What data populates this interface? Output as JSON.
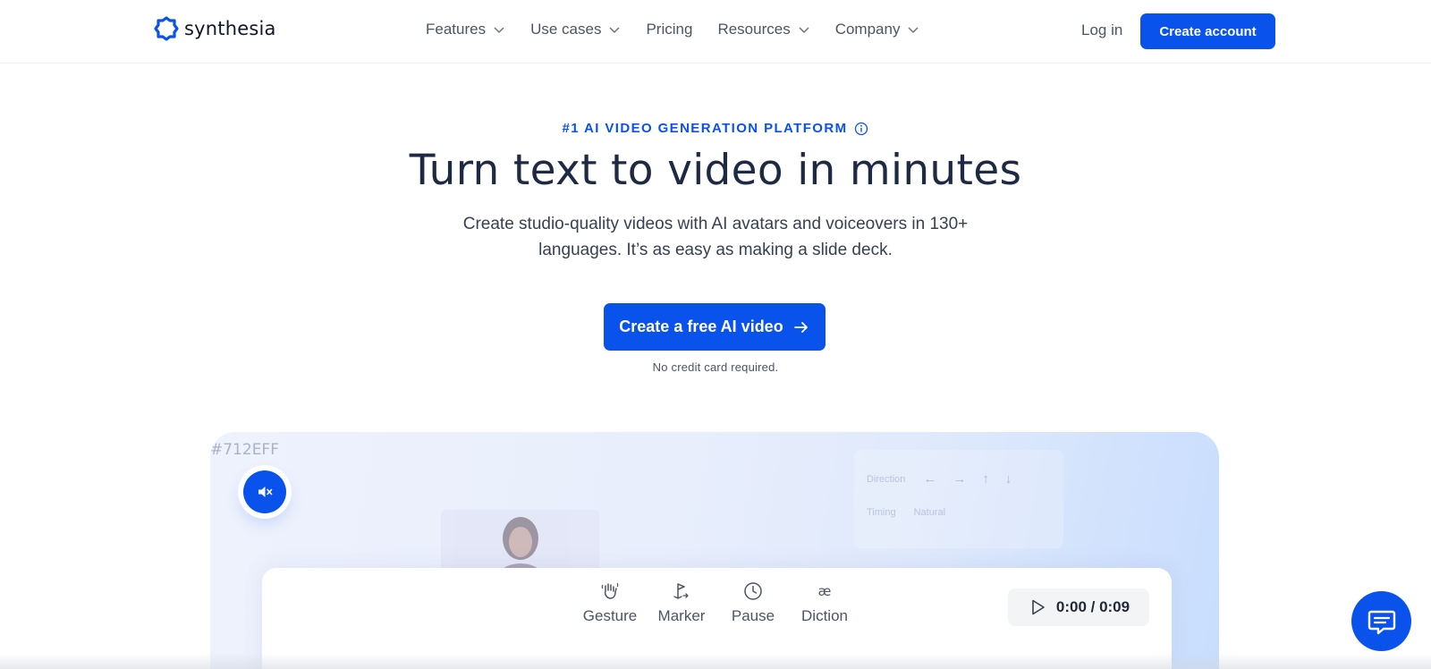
{
  "header": {
    "logo_text": "synthesia",
    "nav": [
      {
        "label": "Features",
        "dropdown": true
      },
      {
        "label": "Use cases",
        "dropdown": true
      },
      {
        "label": "Pricing",
        "dropdown": false
      },
      {
        "label": "Resources",
        "dropdown": true
      },
      {
        "label": "Company",
        "dropdown": true
      }
    ],
    "login_label": "Log in",
    "create_account_label": "Create account"
  },
  "hero": {
    "eyebrow": "#1 AI VIDEO GENERATION PLATFORM",
    "title": "Turn text to video in minutes",
    "subtitle": "Create studio-quality videos with AI avatars and voiceovers in 130+ languages. It’s as easy as making a slide deck.",
    "cta_label": "Create a free AI video",
    "note": "No credit card required."
  },
  "preview": {
    "tag": "#712EFF",
    "mute_icon": "speaker-muted-icon",
    "ghost_panel": {
      "direction_label": "Direction",
      "arrows": [
        "←",
        "→",
        "↑",
        "↓"
      ],
      "timing_label": "Timing",
      "timing_value": "Natural"
    },
    "tools": [
      {
        "label": "Gesture",
        "icon": "hand-wave-icon"
      },
      {
        "label": "Marker",
        "icon": "marker-icon"
      },
      {
        "label": "Pause",
        "icon": "clock-icon"
      },
      {
        "label": "Diction",
        "icon": "diction-icon"
      }
    ],
    "timer": "0:00 / 0:09"
  },
  "chat": {
    "icon": "chat-icon"
  },
  "colors": {
    "brand": "#0A52EC",
    "title": "#1E2A44",
    "text": "#374151",
    "muted": "#4B5563"
  }
}
